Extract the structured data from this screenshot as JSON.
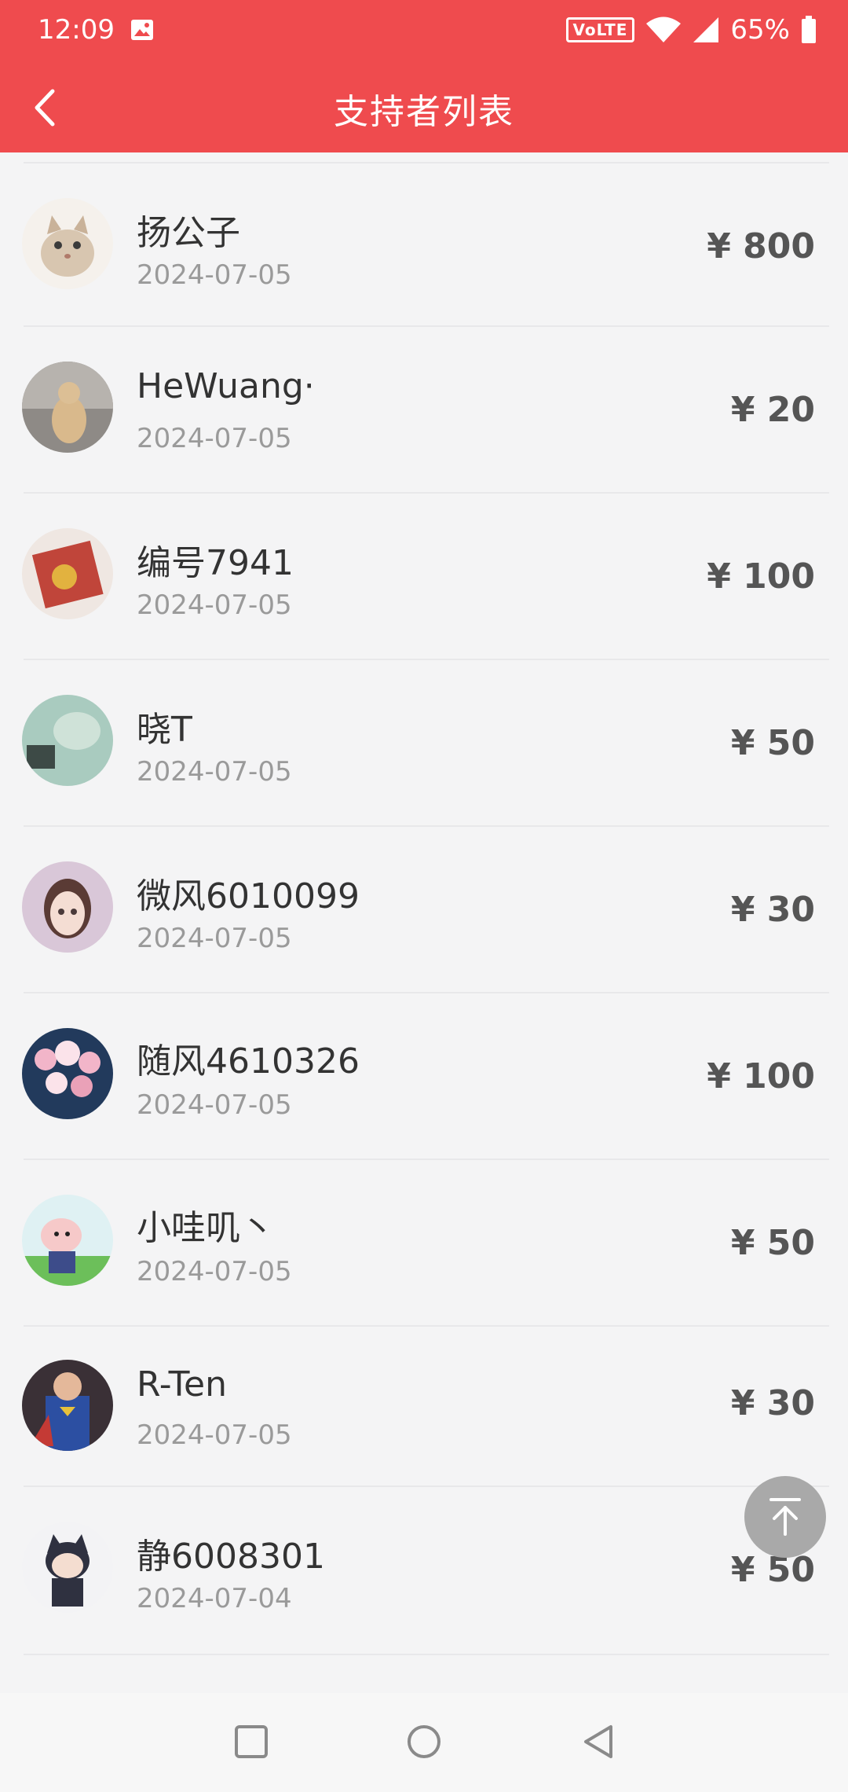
{
  "status_bar": {
    "time": "12:09",
    "volte": "VoLTE",
    "battery": "65%"
  },
  "header": {
    "title": "支持者列表"
  },
  "supporters": [
    {
      "name": "扬公子",
      "date": "2024-07-05",
      "amount": "¥ 800"
    },
    {
      "name": "HeWuang·",
      "date": "2024-07-05",
      "amount": "¥ 20"
    },
    {
      "name": "编号7941",
      "date": "2024-07-05",
      "amount": "¥ 100"
    },
    {
      "name": "晓T",
      "date": "2024-07-05",
      "amount": "¥ 50"
    },
    {
      "name": "微风6010099",
      "date": "2024-07-05",
      "amount": "¥ 30"
    },
    {
      "name": "随风4610326",
      "date": "2024-07-05",
      "amount": "¥ 100"
    },
    {
      "name": "小哇叽丶",
      "date": "2024-07-05",
      "amount": "¥ 50"
    },
    {
      "name": "R-Ten",
      "date": "2024-07-05",
      "amount": "¥ 30"
    },
    {
      "name": "静6008301",
      "date": "2024-07-04",
      "amount": "¥ 50"
    }
  ],
  "colors": {
    "header_bg": "#ef4b4e",
    "page_bg": "#f4f4f5",
    "amount": "#555555",
    "date": "#9a9a9a"
  },
  "icons": {
    "back": "chevron-left-icon",
    "back_to_top": "arrow-up-to-top-icon",
    "nav_recents": "square-icon",
    "nav_home": "circle-icon",
    "nav_back": "triangle-left-icon"
  }
}
